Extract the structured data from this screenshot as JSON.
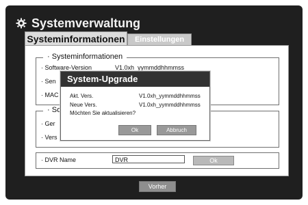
{
  "window": {
    "title": "Systemverwaltung"
  },
  "tabs": [
    {
      "label": "Systeminformationen",
      "active": true
    },
    {
      "label": "Einstellungen",
      "active": false
    }
  ],
  "sysinfo": {
    "legend": "Systeminformationen",
    "rows": [
      {
        "label": "Software-Version",
        "value": "V1.0xh_yymmddhhmmss"
      },
      {
        "label": "Sen",
        "value": ""
      },
      {
        "label": "MAC",
        "value": ""
      }
    ]
  },
  "second_group": {
    "legend": "So",
    "rows": [
      {
        "label": "Ger"
      },
      {
        "label": "Vers"
      }
    ]
  },
  "dvr": {
    "label": "DVR Name",
    "value": "DVR",
    "ok_label": "Ok"
  },
  "dialog": {
    "title": "System-Upgrade",
    "current_label": "Akt. Vers.",
    "current_value": "V1.0xh_yymmddhhmmss",
    "new_label": "Neue Vers.",
    "new_value": "V1.0xh_yymmddhhmmss",
    "question": "Möchten Sie aktualisieren?",
    "ok_label": "Ok",
    "cancel_label": "Abbruch"
  },
  "footer": {
    "back_label": "Vorher"
  },
  "colors": {
    "frame_bg": "#1f1f1f",
    "title_bar": "#323232",
    "button_gray": "#999999"
  }
}
